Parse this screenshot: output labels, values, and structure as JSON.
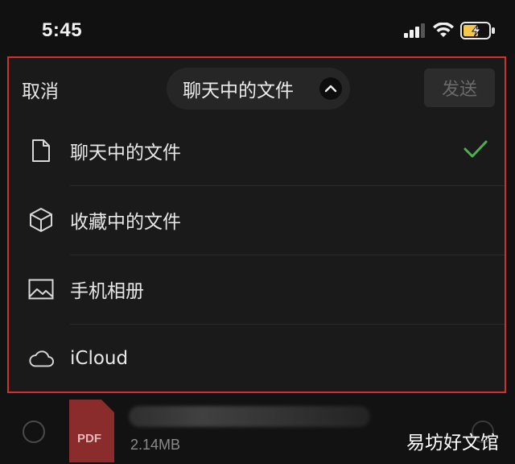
{
  "status_bar": {
    "time": "5:45",
    "icons": [
      "signal-icon",
      "wifi-icon",
      "battery-charging-icon"
    ]
  },
  "header": {
    "cancel_label": "取消",
    "source_selector_label": "聊天中的文件",
    "send_label": "发送"
  },
  "menu": {
    "items": [
      {
        "label": "聊天中的文件",
        "icon": "file-icon",
        "selected": true
      },
      {
        "label": "收藏中的文件",
        "icon": "cube-icon",
        "selected": false
      },
      {
        "label": "手机相册",
        "icon": "image-icon",
        "selected": false
      },
      {
        "label": "iCloud",
        "icon": "cloud-icon",
        "selected": false
      }
    ]
  },
  "file_item": {
    "type_badge": "PDF",
    "size": "2.14MB"
  },
  "watermark": "易坊好文馆",
  "colors": {
    "highlight_border": "#d32f2f",
    "check": "#4caf50",
    "background": "#121212"
  }
}
